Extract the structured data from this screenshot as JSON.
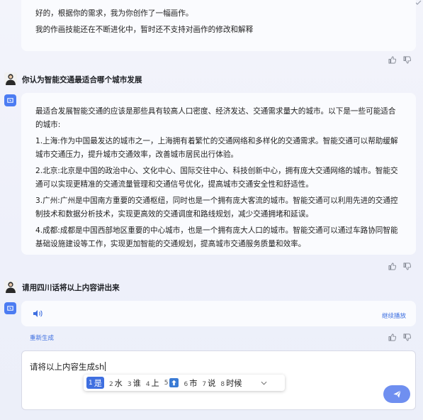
{
  "top_message": {
    "lines": [
      "好的，根据你的需求，我为你创作了一幅画作。",
      "我的作画技能还在不断进化中，暂时还不支持对画作的修改和解释"
    ]
  },
  "question_1": {
    "text": "你认为智能交通最适合哪个城市发展"
  },
  "answer_1": {
    "intro": "最适合发展智能交通的应该是那些具有较高人口密度、经济发达、交通需求量大的城市。以下是一些可能适合的城市:",
    "items": [
      "1.上海:作为中国最发达的城市之一，上海拥有着繁忙的交通网络和多样化的交通需求。智能交通可以帮助缓解城市交通压力，提升城市交通效率，改善城市居民出行体验。",
      "2.北京:北京是中国的政治中心、文化中心、国际交往中心、科技创新中心，拥有庞大交通网络的城市。智能交通可以实现更精准的交通流量管理和交通信号优化，提高城市交通安全性和舒适性。",
      "3.广州:广州是中国南方重要的交通枢纽，同时也是一个拥有庞大客流的城市。智能交通可以利用先进的交通控制技术和数据分析技术，实现更高效的交通调度和路线规划，减少交通拥堵和延误。",
      "4.成都:成都是中国西部地区重要的中心城市，也是一个拥有庞大人口的城市。智能交通可以通过车路协同智能基础设施建设等工作，实现更加智能的交通规划，提高城市交通服务质量和效率。"
    ]
  },
  "question_2": {
    "text": "请用四川话将以上内容讲出来"
  },
  "answer_2": {
    "continue_label": "继续播放",
    "regenerate_label": "重新生成"
  },
  "input": {
    "value": "请将以上内容生成sh"
  },
  "ime": {
    "candidates": [
      {
        "num": "1",
        "text": "是"
      },
      {
        "num": "2",
        "text": "水"
      },
      {
        "num": "3",
        "text": "谁"
      },
      {
        "num": "4",
        "text": "上"
      },
      {
        "num": "5",
        "text": ""
      },
      {
        "num": "6",
        "text": "市"
      },
      {
        "num": "7",
        "text": "说"
      },
      {
        "num": "8",
        "text": "时候"
      }
    ]
  },
  "icons": {
    "thumb_up": "thumb-up-icon",
    "thumb_down": "thumb-down-icon",
    "speaker": "speaker-icon",
    "send": "send-icon",
    "expand": "chevron-down-icon"
  },
  "colors": {
    "accent": "#3f6fe0",
    "send_button": "#6f8ff0",
    "ai_avatar": "#4c7cf2"
  }
}
